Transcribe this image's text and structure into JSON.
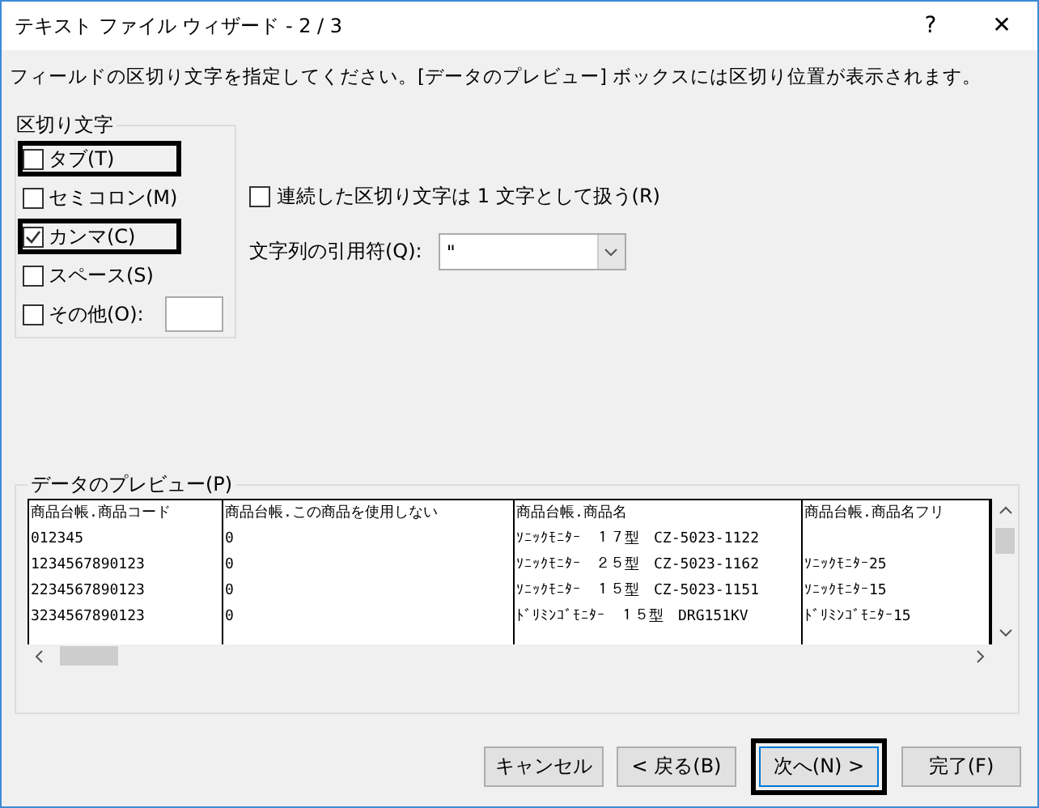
{
  "window": {
    "title": "テキスト ファイル ウィザード - 2 / 3",
    "help": "?",
    "close": "✕"
  },
  "instruction": "フィールドの区切り文字を指定してください。[データのプレビュー] ボックスには区切り位置が表示されます。",
  "delimiters": {
    "title": "区切り文字",
    "options": [
      {
        "kind": "check",
        "label": "タブ(T)",
        "checked": false,
        "highlighted": true
      },
      {
        "kind": "check",
        "label": "セミコロン(M)",
        "checked": false,
        "highlighted": false
      },
      {
        "kind": "check",
        "label": "カンマ(C)",
        "checked": true,
        "highlighted": true
      },
      {
        "kind": "check",
        "label": "スペース(S)",
        "checked": false,
        "highlighted": false
      },
      {
        "kind": "other",
        "label": "その他(O):",
        "checked": false,
        "highlighted": false
      }
    ]
  },
  "consecutive": {
    "label": "連続した区切り文字は 1 文字として扱う(R)",
    "checked": false
  },
  "qualifier": {
    "label": "文字列の引用符(Q):",
    "value": "\""
  },
  "preview": {
    "title": "データのプレビュー(P)",
    "rows": [
      [
        "商品台帳.商品コード",
        "商品台帳.この商品を使用しない",
        "商品台帳.商品名",
        "商品台帳.商品名フリ"
      ],
      [
        "012345",
        "0",
        "ｿﾆｯｸﾓﾆﾀｰ　１７型　CZ-5023-1122"
      ],
      [
        "1234567890123",
        "0",
        "ｿﾆｯｸﾓﾆﾀｰ　２５型　CZ-5023-1162",
        "ｿﾆｯｸﾓﾆﾀｰ25"
      ],
      [
        "2234567890123",
        "0",
        "ｿﾆｯｸﾓﾆﾀｰ　１５型　CZ-5023-1151",
        "ｿﾆｯｸﾓﾆﾀｰ15"
      ],
      [
        "3234567890123",
        "0",
        "ﾄﾞﾘﾐﾝｺﾞﾓﾆﾀｰ　１５型　DRG151KV",
        "ﾄﾞﾘﾐﾝｺﾞﾓﾆﾀｰ15"
      ]
    ]
  },
  "buttons": [
    {
      "label": "キャンセル",
      "highlighted": false
    },
    {
      "label": "< 戻る(B)",
      "highlighted": false
    },
    {
      "label": "次へ(N) >",
      "highlighted": true
    },
    {
      "label": "完了(F)",
      "highlighted": false
    }
  ]
}
